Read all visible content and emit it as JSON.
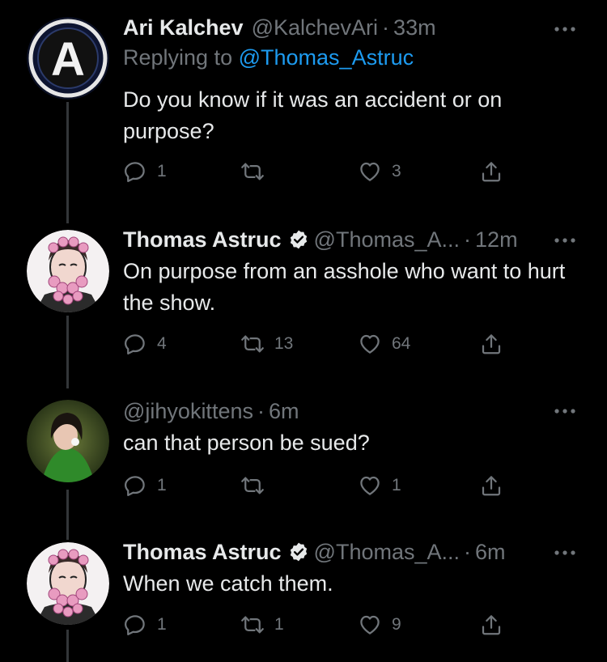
{
  "tweets": [
    {
      "name": "Ari Kalchev",
      "verified": false,
      "handle": "@KalchevAri",
      "time": "33m",
      "replying_label": "Replying to",
      "replying_to": "@Thomas_Astruc",
      "text": "Do you know if it was an accident or on purpose?",
      "replies": "1",
      "retweets": "",
      "likes": "3",
      "avatar_letter": "A"
    },
    {
      "name": "Thomas Astruc",
      "verified": true,
      "handle": "@Thomas_A...",
      "time": "12m",
      "text": "On purpose from an asshole who want to hurt the show.",
      "replies": "4",
      "retweets": "13",
      "likes": "64"
    },
    {
      "name": "",
      "verified": false,
      "handle": "@jihyokittens",
      "time": "6m",
      "text": "can that person be sued?",
      "replies": "1",
      "retweets": "",
      "likes": "1"
    },
    {
      "name": "Thomas Astruc",
      "verified": true,
      "handle": "@Thomas_A...",
      "time": "6m",
      "text": "When we catch them.",
      "replies": "1",
      "retweets": "1",
      "likes": "9"
    }
  ],
  "separator": "·",
  "icons": {
    "reply": "reply-icon",
    "retweet": "retweet-icon",
    "like": "heart-icon",
    "share": "share-icon",
    "more": "more-icon",
    "verified": "verified-badge-icon"
  },
  "colors": {
    "background": "#000000",
    "text": "#e7e9ea",
    "secondary": "#71767b",
    "link": "#1d9bf0",
    "thread_line": "#333639"
  }
}
